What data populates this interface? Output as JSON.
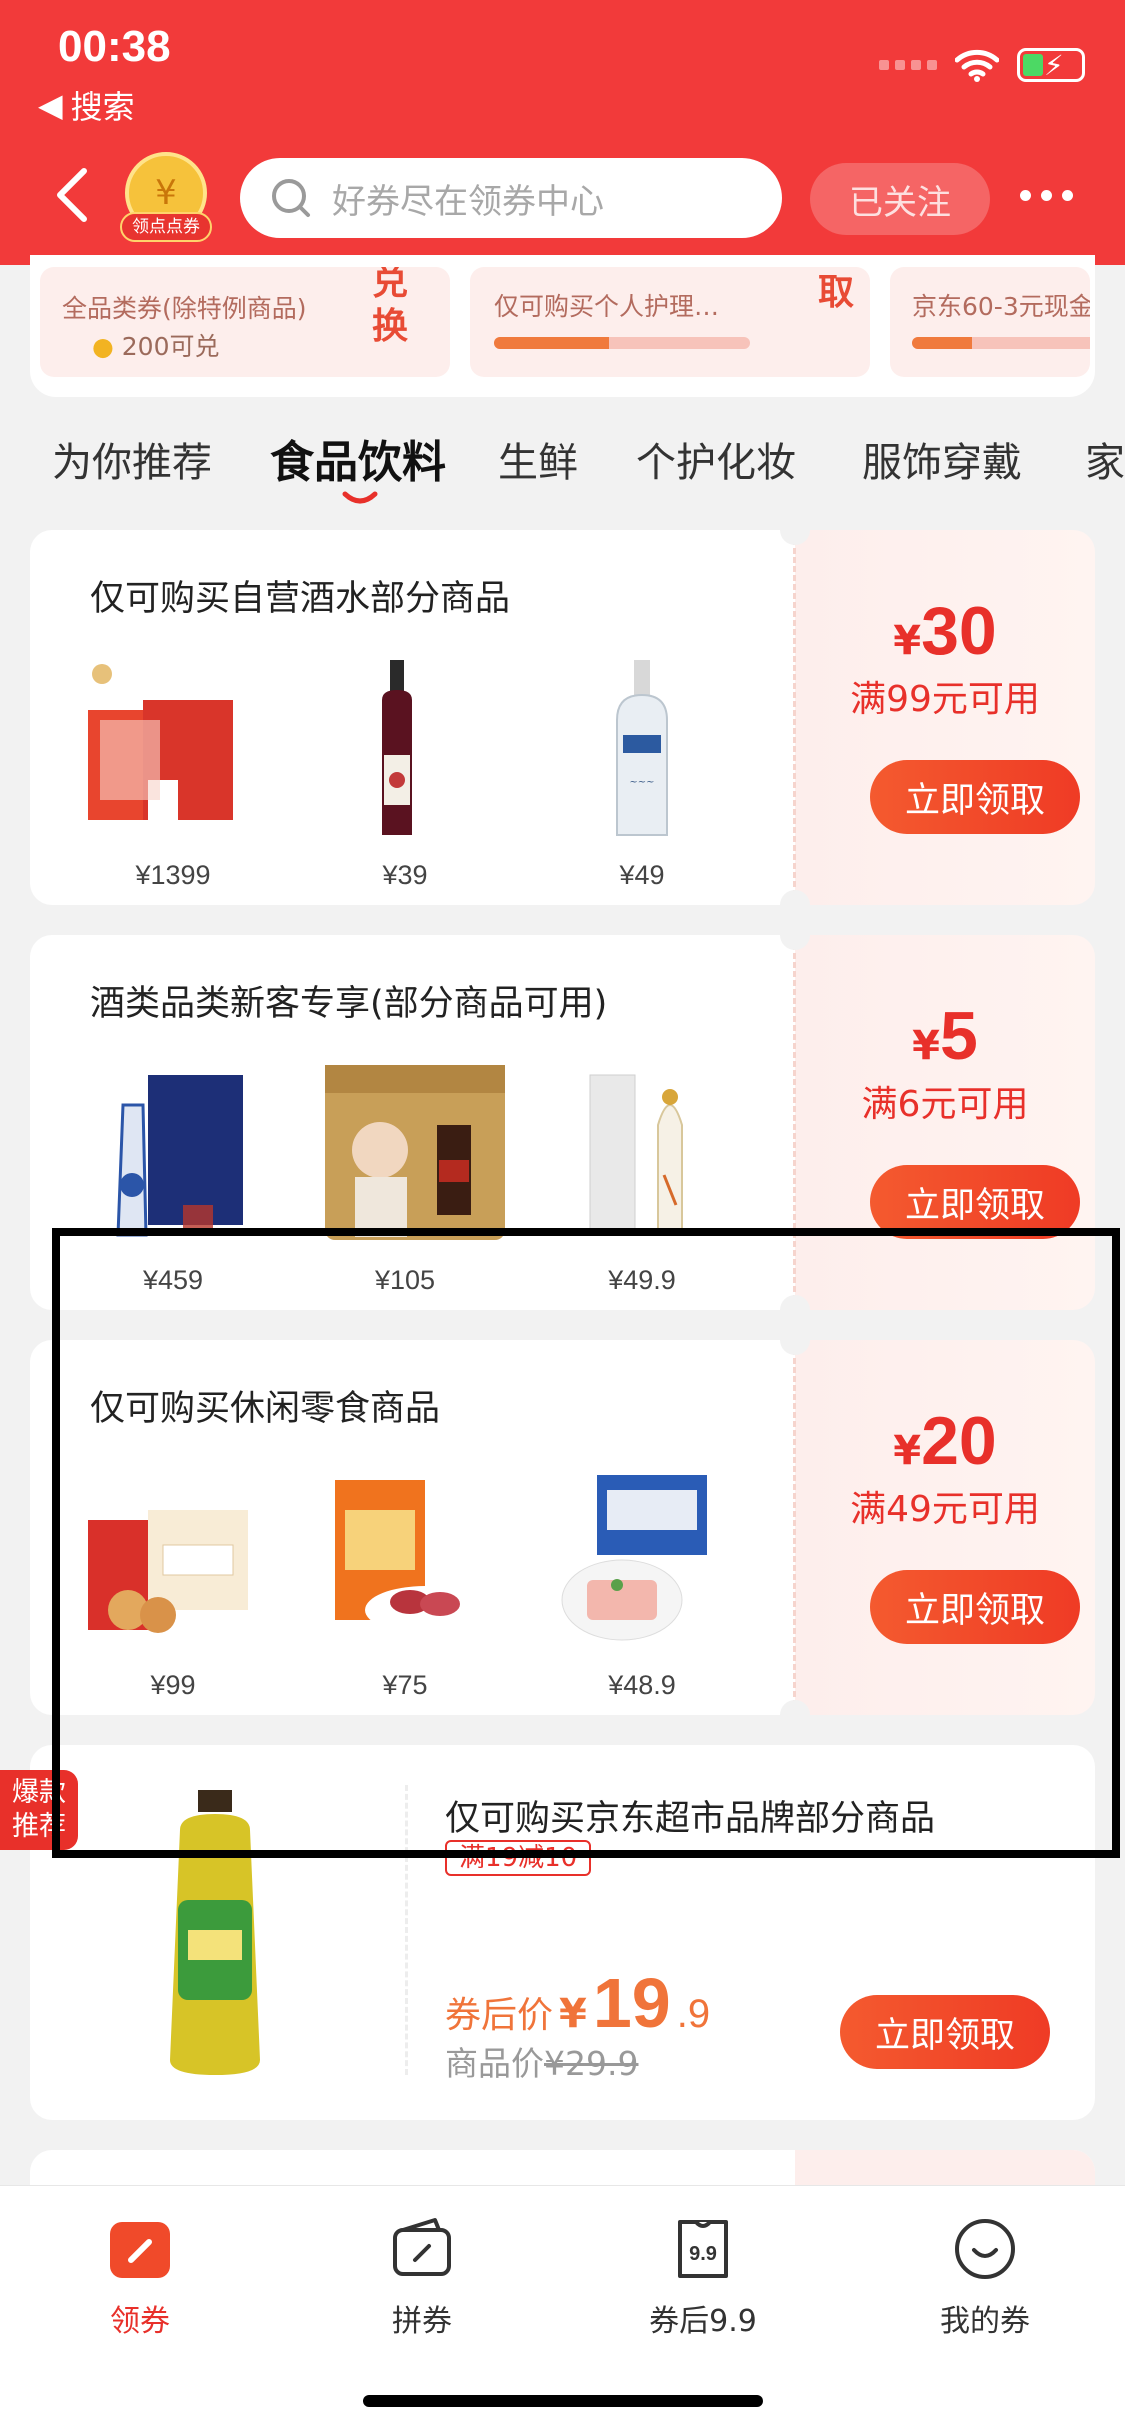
{
  "status": {
    "time": "00:38",
    "back_app": "搜索"
  },
  "header": {
    "coin_label": "领点点券",
    "search_placeholder": "好券尽在领券中心",
    "follow_label": "已关注"
  },
  "exchange": {
    "card1_line1": "全品类券(除特例商品)",
    "card1_points": "200可兑",
    "card1_action": "兑换",
    "card2_line1": "仅可购买个人护理…",
    "card2_action": "取",
    "card2_progress": 0.45,
    "card3_line1": "京东60-3元现金",
    "card3_progress": 0.3
  },
  "tabs": [
    "为你推荐",
    "食品饮料",
    "生鲜",
    "个护化妆",
    "服饰穿戴",
    "家"
  ],
  "active_tab_index": 1,
  "coupons": [
    {
      "title": "仅可购买自营酒水部分商品",
      "amount": "30",
      "currency": "¥",
      "condition": "满99元可用",
      "button": "立即领取",
      "prices": [
        "¥1399",
        "¥39",
        "¥49"
      ]
    },
    {
      "title": "酒类品类新客专享(部分商品可用)",
      "amount": "5",
      "currency": "¥",
      "condition": "满6元可用",
      "button": "立即领取",
      "prices": [
        "¥459",
        "¥105",
        "¥49.9"
      ]
    },
    {
      "title": "仅可购买休闲零食商品",
      "amount": "20",
      "currency": "¥",
      "condition": "满49元可用",
      "button": "立即领取",
      "prices": [
        "¥99",
        "¥75",
        "¥48.9"
      ]
    }
  ],
  "special": {
    "badge": "爆款推荐",
    "title": "仅可购买京东超市品牌部分商品",
    "tag": "满19减10",
    "after_label": "券后价",
    "currency": "¥",
    "after_int": "19",
    "after_dec": ".9",
    "orig_label": "商品价",
    "orig_price": "¥29.9",
    "button": "立即领取"
  },
  "bottom_nav": [
    {
      "label": "领券",
      "icon": "coupon-icon",
      "active": true
    },
    {
      "label": "拼券",
      "icon": "wallet-icon",
      "active": false
    },
    {
      "label": "券后9.9",
      "icon": "ticket-99-icon",
      "active": false
    },
    {
      "label": "我的券",
      "icon": "smile-icon",
      "active": false
    }
  ],
  "nav_icon_text_99": "9.9",
  "colors": {
    "brand_red": "#f23a3a",
    "accent": "#e8302a",
    "orange": "#f0743a"
  }
}
